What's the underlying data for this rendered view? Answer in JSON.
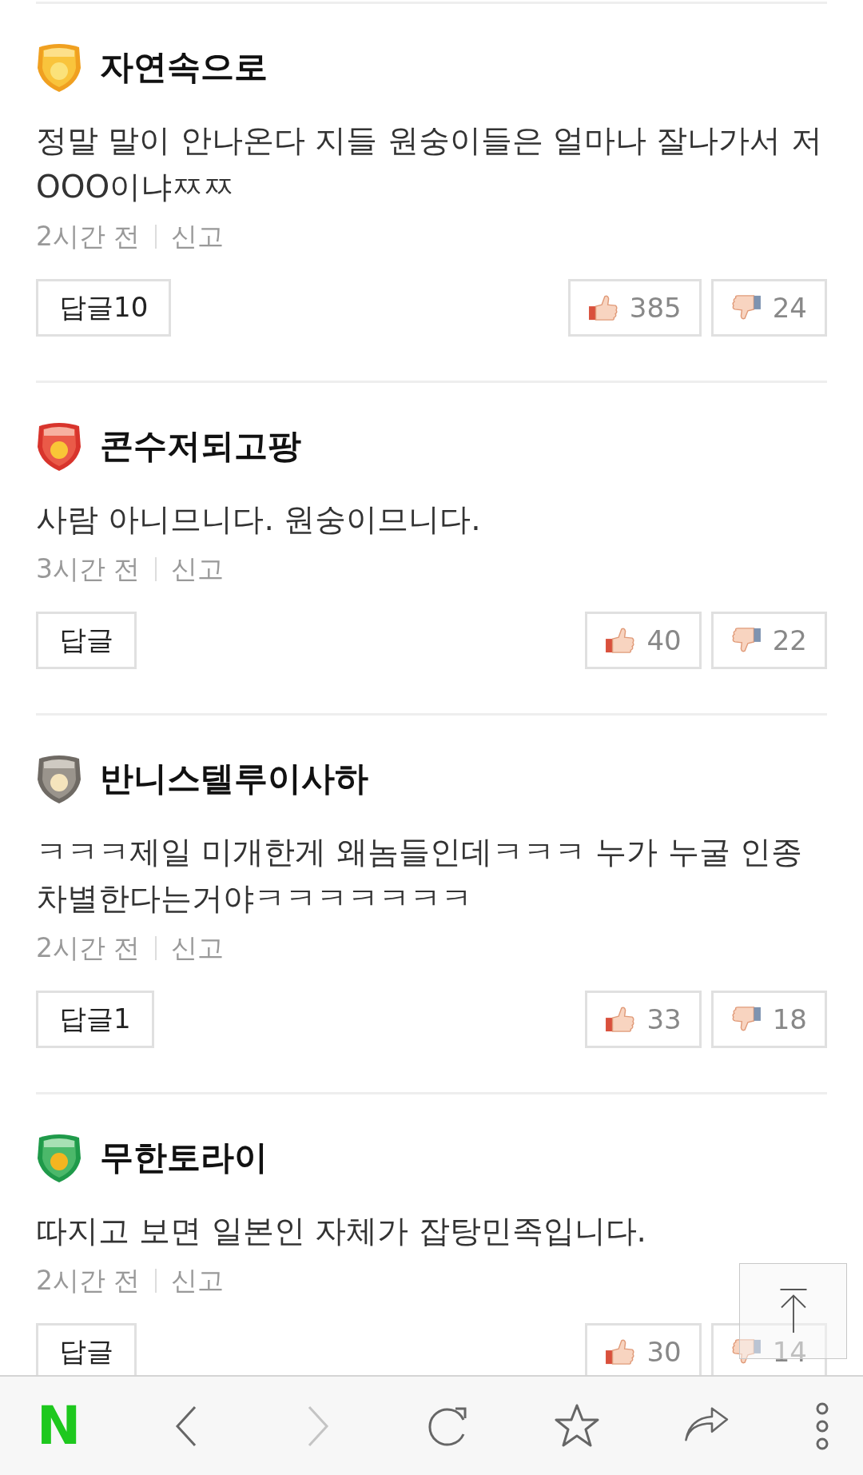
{
  "comments": [
    {
      "badge": {
        "kind": "master"
      },
      "author": "자연속으로",
      "text": "정말 말이 안나온다 지들 원숭이들은 얼마나 잘나가서 저 OOO이냐ㅉㅉ",
      "time": "2시간 전",
      "report": "신고",
      "reply": "답글10",
      "likes": "385",
      "dislikes": "24"
    },
    {
      "badge": {
        "kind": "senpro"
      },
      "author": "콘수저되고팡",
      "text": "사람 아니므니다. 원숭이므니다.",
      "time": "3시간 전",
      "report": "신고",
      "reply": "답글",
      "likes": "40",
      "dislikes": "22"
    },
    {
      "badge": {
        "kind": "rookie"
      },
      "author": "반니스텔루이사하",
      "text": "ㅋㅋㅋ제일 미개한게 왜놈들인데ㅋㅋㅋ 누가 누굴 인종차별한다는거야ㅋㅋㅋㅋㅋㅋㅋ",
      "time": "2시간 전",
      "report": "신고",
      "reply": "답글1",
      "likes": "33",
      "dislikes": "18"
    },
    {
      "badge": {
        "kind": "amateur"
      },
      "author": "무한토라이",
      "text": "따지고 보면 일본인 자체가 잡탕민족입니다.",
      "time": "2시간 전",
      "report": "신고",
      "reply": "답글",
      "likes": "30",
      "dislikes": "14"
    }
  ],
  "toolbar": {
    "logo": "N",
    "forward_disabled": true
  }
}
